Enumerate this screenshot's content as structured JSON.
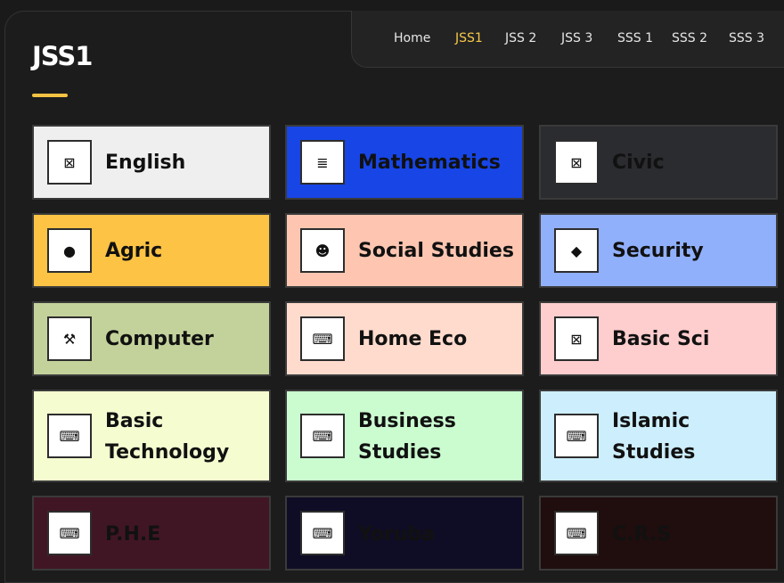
{
  "page": {
    "title": "JSS1"
  },
  "nav": {
    "items": [
      {
        "label": "Home",
        "active": false
      },
      {
        "label": "JSS1",
        "active": true
      },
      {
        "label": "JSS 2",
        "active": false
      },
      {
        "label": "JSS 3",
        "active": false
      },
      {
        "label": "SSS 1",
        "active": false
      },
      {
        "label": "SSS 2",
        "active": false
      },
      {
        "label": "SSS 3",
        "active": false
      }
    ]
  },
  "subjects": [
    {
      "name": "English",
      "icon": "document-icon",
      "color": "#efefef"
    },
    {
      "name": "Mathematics",
      "icon": "chart-icon",
      "color": "#1745e6"
    },
    {
      "name": "Civic",
      "icon": "document-icon",
      "color": "#2b2c30"
    },
    {
      "name": "Agric",
      "icon": "lightbulb-icon",
      "color": "#fdc344"
    },
    {
      "name": "Social Studies",
      "icon": "smiley-icon",
      "color": "#fec6b1"
    },
    {
      "name": "Security",
      "icon": "diamond-icon",
      "color": "#91b0fc"
    },
    {
      "name": "Computer",
      "icon": "gavel-icon",
      "color": "#c3d29b"
    },
    {
      "name": "Home Eco",
      "icon": "keyboard-icon",
      "color": "#fedbcd"
    },
    {
      "name": "Basic Sci",
      "icon": "document-icon",
      "color": "#fecdcd"
    },
    {
      "name": "Basic Technology",
      "icon": "keyboard-icon",
      "color": "#f5fdd0"
    },
    {
      "name": "Business Studies",
      "icon": "keyboard-icon",
      "color": "#cbfcd0"
    },
    {
      "name": "Islamic Studies",
      "icon": "keyboard-icon",
      "color": "#cdeefc"
    },
    {
      "name": "P.H.E",
      "icon": "keyboard-icon",
      "color": "#411624"
    },
    {
      "name": "Yoruba",
      "icon": "keyboard-icon",
      "color": "#0f0d25"
    },
    {
      "name": "C.R.S",
      "icon": "keyboard-icon",
      "color": "#200d0d"
    }
  ]
}
